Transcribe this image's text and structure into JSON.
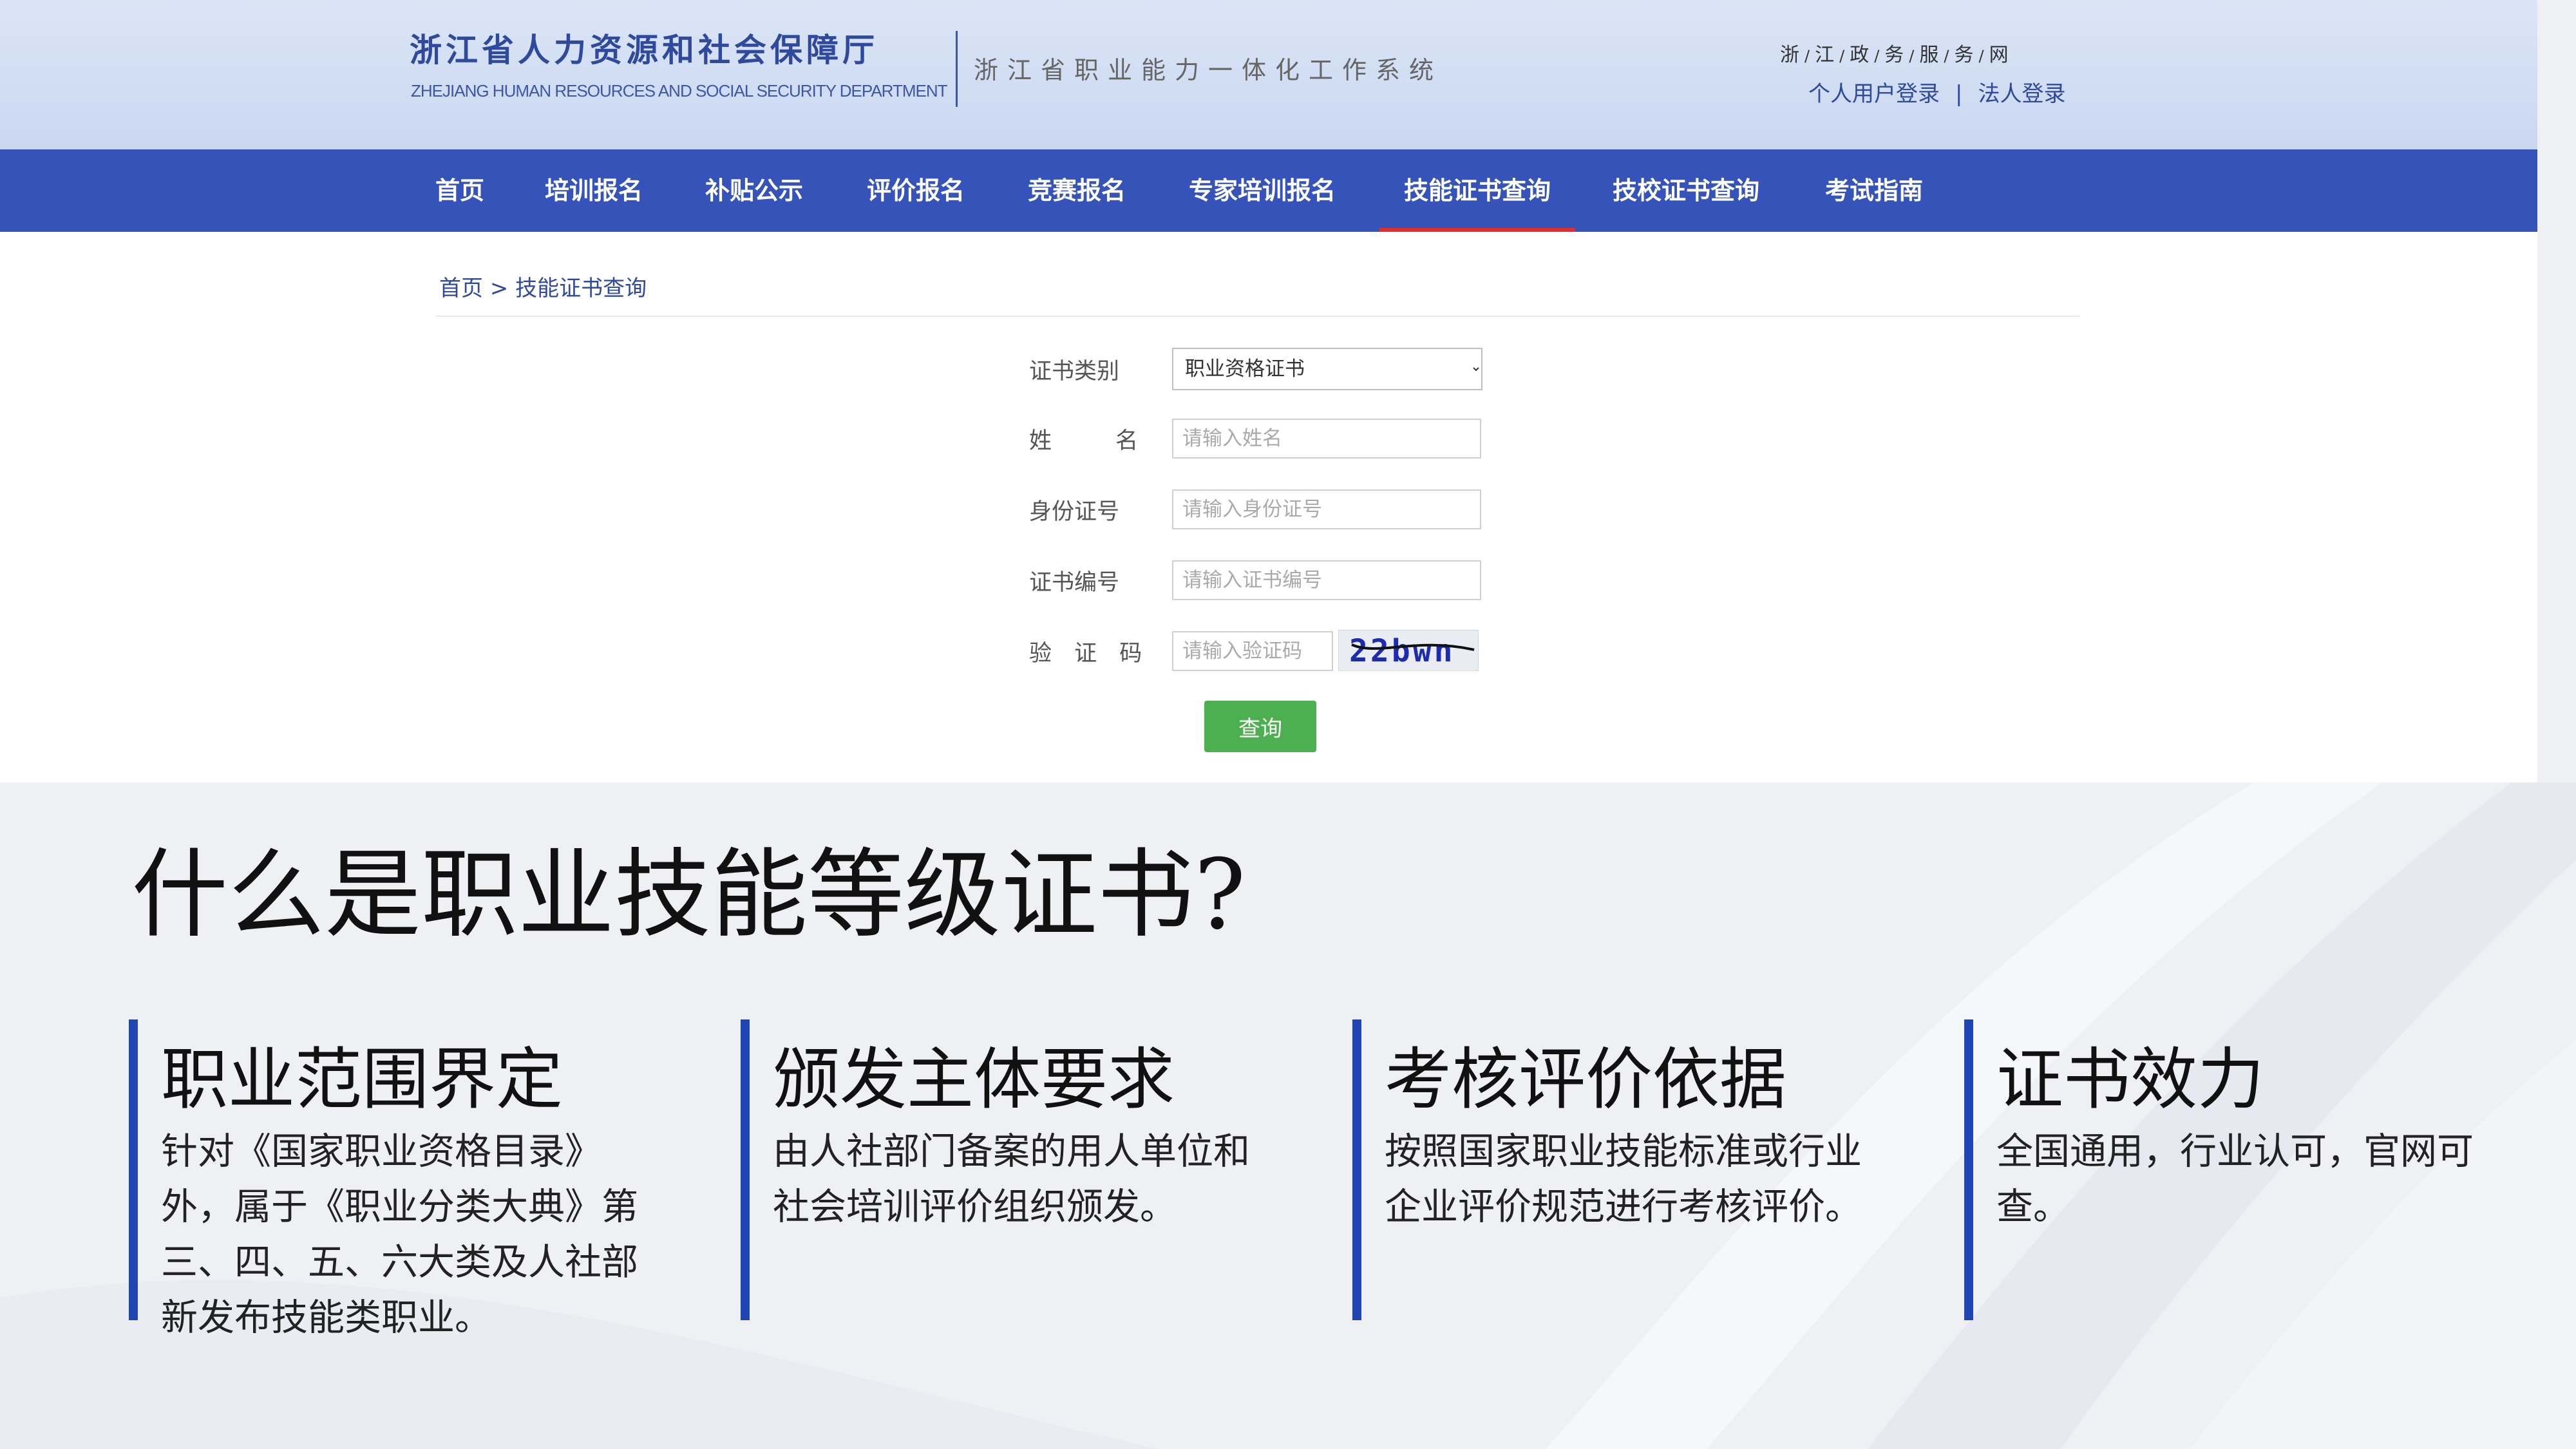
{
  "site": {
    "logo_cn": "浙江省人力资源和社会保障厅",
    "logo_en": "ZHEJIANG HUMAN RESOURCES AND SOCIAL SECURITY DEPARTMENT",
    "system_title": "浙江省职业能力一体化工作系统",
    "portal_chars": [
      "浙",
      "江",
      "政",
      "务",
      "服",
      "务",
      "网"
    ],
    "portal_sep": "/",
    "login_personal": "个人用户登录",
    "login_sep": "|",
    "login_legal": "法人登录"
  },
  "nav": {
    "items": [
      "首页",
      "培训报名",
      "补贴公示",
      "评价报名",
      "竞赛报名",
      "专家培训报名",
      "技能证书查询",
      "技校证书查询",
      "考试指南"
    ],
    "active_index": 6,
    "active_color": "#e02e2e",
    "bar_color": "#3553b8"
  },
  "breadcrumb": "首页 > 技能证书查询",
  "form": {
    "cert_type_label": "证书类别",
    "cert_type_value": "职业资格证书",
    "name_label": "姓 名",
    "name_placeholder": "请输入姓名",
    "id_label": "身份证号",
    "id_placeholder": "请输入身份证号",
    "cert_no_label": "证书编号",
    "cert_no_placeholder": "请输入证书编号",
    "captcha_label": "验 证 码",
    "captcha_placeholder": "请输入验证码",
    "captcha_text": "22bwn",
    "query_button": "查询"
  },
  "slide": {
    "title": "什么是职业技能等级证书?",
    "accent_color": "#1f45b5",
    "cards": [
      {
        "heading": "职业范围界定",
        "body": "针对《国家职业资格目录》外，属于《职业分类大典》第三、四、五、六大类及人社部新发布技能类职业。"
      },
      {
        "heading": "颁发主体要求",
        "body": "由人社部门备案的用人单位和社会培训评价组织颁发。"
      },
      {
        "heading": "考核评价依据",
        "body": "按照国家职业技能标准或行业企业评价规范进行考核评价。"
      },
      {
        "heading": "证书效力",
        "body": "全国通用，行业认可，官网可查。"
      }
    ]
  }
}
